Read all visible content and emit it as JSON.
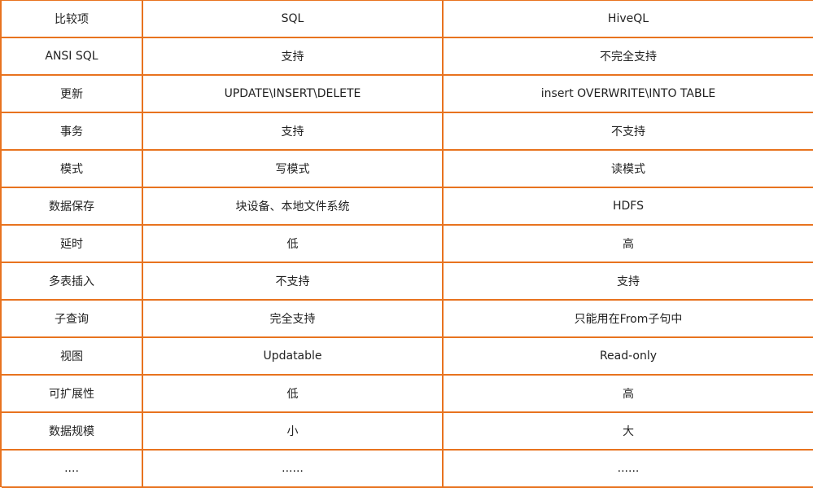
{
  "accent_color": "#e8731f",
  "table": {
    "header": [
      "比较项",
      "SQL",
      "HiveQL"
    ],
    "rows": [
      [
        "ANSI SQL",
        "支持",
        "不完全支持"
      ],
      [
        "更新",
        "UPDATE\\INSERT\\DELETE",
        "insert OVERWRITE\\INTO TABLE"
      ],
      [
        "事务",
        "支持",
        "不支持"
      ],
      [
        "模式",
        "写模式",
        "读模式"
      ],
      [
        "数据保存",
        "块设备、本地文件系统",
        "HDFS"
      ],
      [
        "延时",
        "低",
        "高"
      ],
      [
        "多表插入",
        "不支持",
        "支持"
      ],
      [
        "子查询",
        "完全支持",
        "只能用在From子句中"
      ],
      [
        "视图",
        "Updatable",
        "Read-only"
      ],
      [
        "可扩展性",
        "低",
        "高"
      ],
      [
        "数据规模",
        "小",
        "大"
      ],
      [
        "....",
        "......",
        "......"
      ]
    ]
  }
}
